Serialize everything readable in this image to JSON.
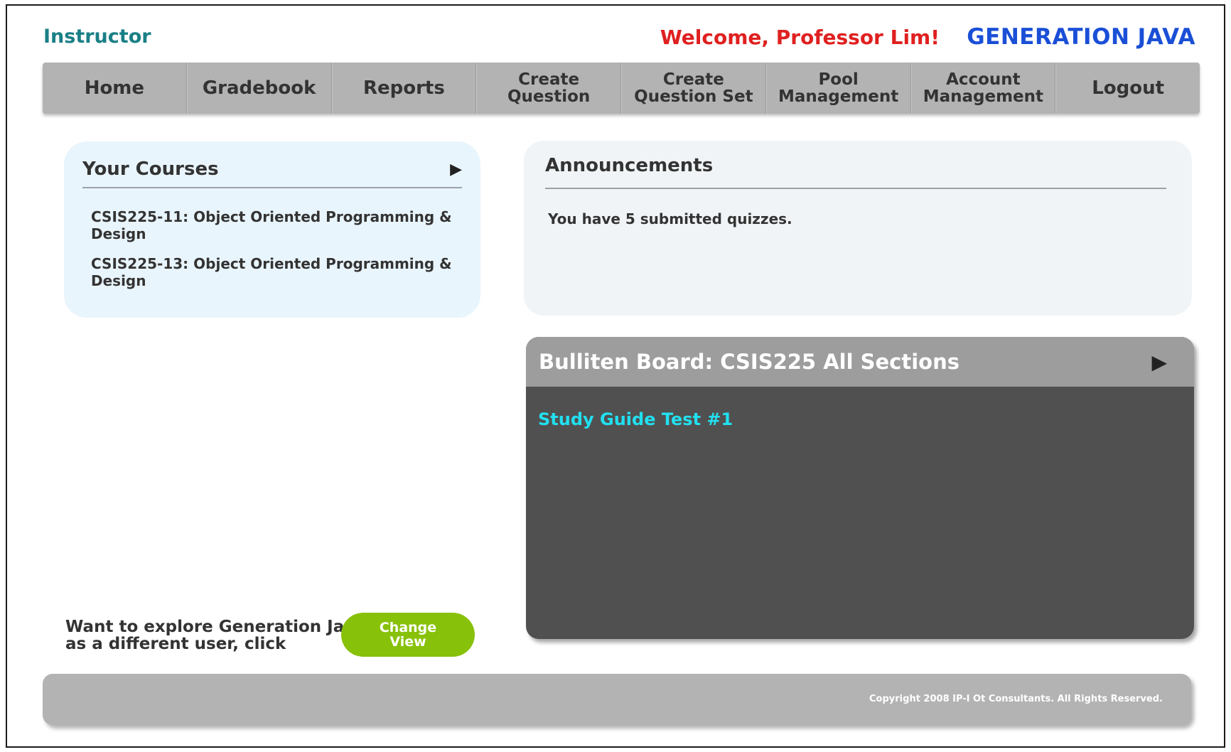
{
  "header": {
    "role_label": "Instructor",
    "welcome_text": "Welcome, Professor Lim!",
    "brand": "GENERATION JAVA"
  },
  "nav": {
    "items": [
      {
        "label": "Home"
      },
      {
        "label": "Gradebook"
      },
      {
        "label": "Reports"
      },
      {
        "label": "Create Question"
      },
      {
        "label": "Create Question Set"
      },
      {
        "label": "Pool Management"
      },
      {
        "label": "Account Management"
      },
      {
        "label": "Logout"
      }
    ]
  },
  "courses": {
    "title": "Your Courses",
    "items": [
      "CSIS225-11: Object Oriented Programming & Design",
      "CSIS225-13: Object Oriented Programming & Design"
    ]
  },
  "announcements": {
    "title": "Announcements",
    "text": "You have 5 submitted quizzes."
  },
  "bulletin": {
    "title": "Bulliten Board: CSIS225 All Sections",
    "link": "Study Guide Test #1"
  },
  "explore": {
    "line1": "Want to explore Generation Java",
    "line2": "as a different user, click",
    "button_line1": "Change",
    "button_line2": "View"
  },
  "footer": {
    "copyright": "Copyright 2008 IP-I Ot Consultants. All Rights Reserved."
  },
  "colors": {
    "role": "#1a7f86",
    "welcome": "#e02020",
    "brand": "#1a4fd6",
    "nav_bg": "#b3b3b3",
    "courses_bg": "#e9f5fc",
    "bulletin_bg": "#505050",
    "link": "#21e0ef",
    "button": "#88c10a"
  }
}
